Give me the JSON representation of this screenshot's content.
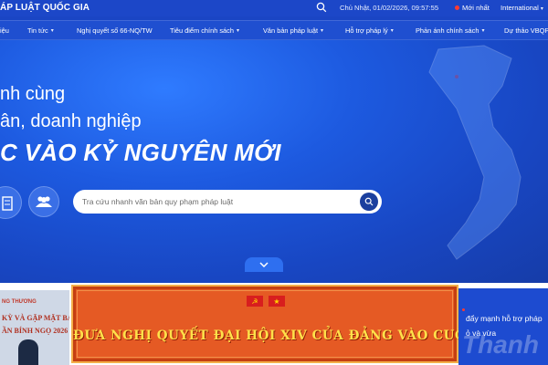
{
  "topbar": {
    "site_title": "ÁP LUẬT QUỐC GIA",
    "datetime": "Chủ Nhật, 01/02/2026, 09:57:55",
    "new_label": "Mới nhất",
    "language_label": "International"
  },
  "nav": {
    "items": [
      {
        "label": "iệu",
        "has_caret": false
      },
      {
        "label": "Tin tức",
        "has_caret": true
      },
      {
        "label": "Nghị quyết số 66-NQ/TW",
        "has_caret": false
      },
      {
        "label": "Tiêu điểm chính sách",
        "has_caret": true
      },
      {
        "label": "Văn bản pháp luật",
        "has_caret": true
      },
      {
        "label": "Hỗ trợ pháp lý",
        "has_caret": true
      },
      {
        "label": "Phản ánh chính sách",
        "has_caret": true
      },
      {
        "label": "Dự thảo VBQPPL",
        "has_caret": false
      }
    ]
  },
  "hero": {
    "line1": "nh cùng",
    "line2": "ân, doanh nghiệp",
    "line3": "C VÀO KỶ NGUYÊN MỚI",
    "search_placeholder": "Tra cứu nhanh văn bản quy phạm pháp luật"
  },
  "bottom": {
    "thumb_left": {
      "line1": "NG THƯƠNG",
      "line2": "KỲ VÀ GẶP MẶT BÁC",
      "line3": "ẦN BÍNH NGỌ 2026"
    },
    "banner_text": "ĐƯA NGHỊ QUYẾT ĐẠI HỘI XIV CỦA ĐẢNG VÀO CUỘC SỐNG",
    "right_news": {
      "line1": "đẩy mạnh hỗ trợ pháp",
      "line2": "ỏ và vừa"
    },
    "watermark": "Thanh"
  },
  "colors": {
    "primary": "#1c47c8",
    "banner": "#e55a24",
    "banner_text": "#ffe14a",
    "accent_red": "#ff3b30"
  },
  "icons": [
    "search-icon",
    "chevron-down-icon",
    "building-icon",
    "people-icon"
  ]
}
